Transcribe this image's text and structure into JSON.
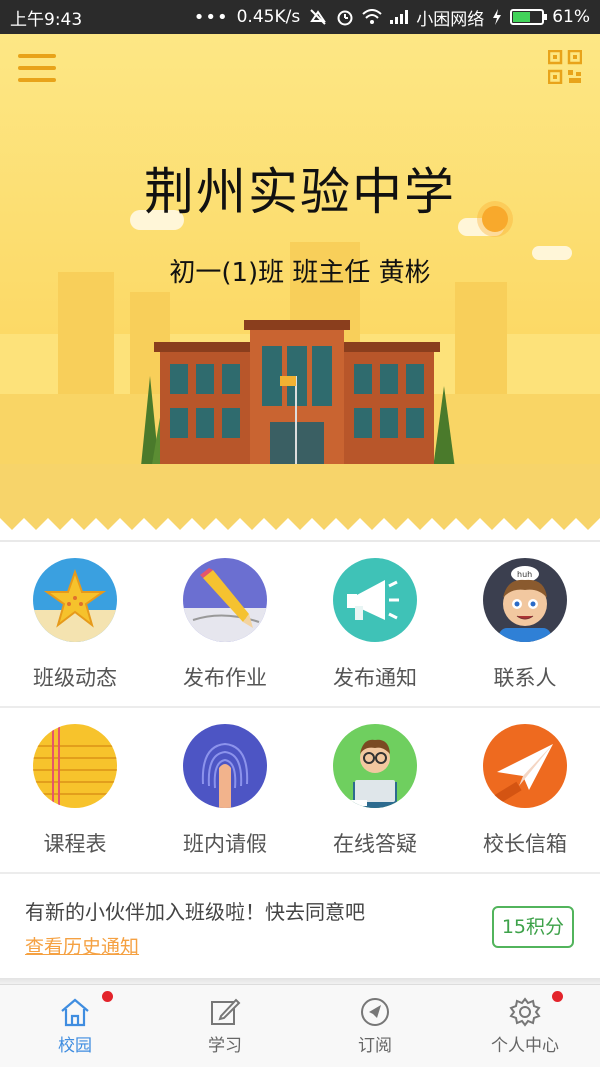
{
  "status_bar": {
    "time": "上午9:43",
    "dots": "•••",
    "speed": "0.45K/s",
    "carrier": "小困网络",
    "battery": "61%",
    "battery_level": 0.61
  },
  "header": {
    "school_name": "荆州实验中学",
    "class_info": "初一(1)班 班主任 黄彬"
  },
  "grid": {
    "items": [
      {
        "label": "班级动态",
        "icon": "starfish-icon"
      },
      {
        "label": "发布作业",
        "icon": "pencil-icon"
      },
      {
        "label": "发布通知",
        "icon": "megaphone-icon"
      },
      {
        "label": "联系人",
        "icon": "contact-face-icon"
      },
      {
        "label": "课程表",
        "icon": "notebook-icon"
      },
      {
        "label": "班内请假",
        "icon": "fingerprint-icon"
      },
      {
        "label": "在线答疑",
        "icon": "teacher-laptop-icon"
      },
      {
        "label": "校长信箱",
        "icon": "paper-plane-icon"
      }
    ]
  },
  "notice": {
    "text": "有新的小伙伴加入班级啦！快去同意吧",
    "link": "查看历史通知",
    "points": "15积分"
  },
  "bottom_nav": {
    "items": [
      {
        "label": "校园",
        "icon": "home-icon",
        "active": true,
        "badge": true
      },
      {
        "label": "学习",
        "icon": "edit-icon",
        "active": false,
        "badge": false
      },
      {
        "label": "订阅",
        "icon": "compass-icon",
        "active": false,
        "badge": false
      },
      {
        "label": "个人中心",
        "icon": "gear-icon",
        "active": false,
        "badge": true
      }
    ]
  },
  "colors": {
    "banner": "#fde27a",
    "accent_orange": "#f5a142",
    "nav_active": "#3f8de0",
    "badge_red": "#e3242b",
    "points_green": "#3ea24a"
  }
}
